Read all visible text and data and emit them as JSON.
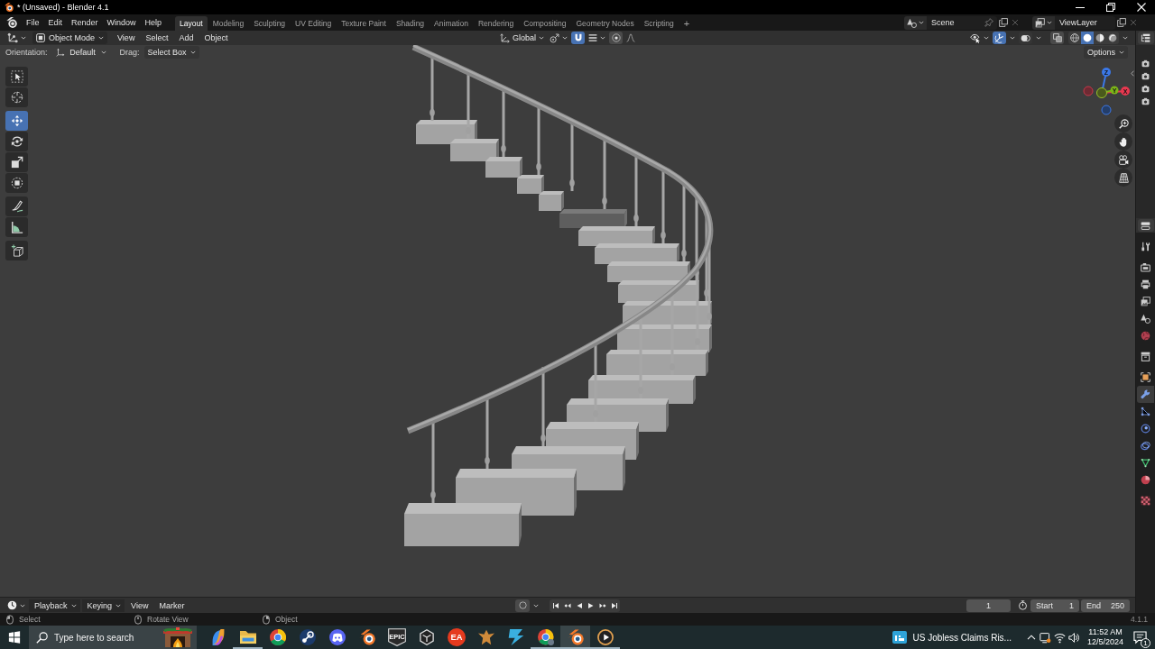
{
  "window": {
    "title": "* (Unsaved) - Blender 4.1"
  },
  "topbar": {
    "menus": [
      "File",
      "Edit",
      "Render",
      "Window",
      "Help"
    ],
    "workspaces": [
      {
        "label": "Layout",
        "selected": true
      },
      {
        "label": "Modeling",
        "selected": false
      },
      {
        "label": "Sculpting",
        "selected": false
      },
      {
        "label": "UV Editing",
        "selected": false
      },
      {
        "label": "Texture Paint",
        "selected": false
      },
      {
        "label": "Shading",
        "selected": false
      },
      {
        "label": "Animation",
        "selected": false
      },
      {
        "label": "Rendering",
        "selected": false
      },
      {
        "label": "Compositing",
        "selected": false
      },
      {
        "label": "Geometry Nodes",
        "selected": false
      },
      {
        "label": "Scripting",
        "selected": false
      }
    ],
    "add_workspace": "+",
    "scene": "Scene",
    "view_layer": "ViewLayer"
  },
  "viewport": {
    "header": {
      "mode": "Object Mode",
      "menus": [
        "View",
        "Select",
        "Add",
        "Object"
      ],
      "transform_orientation": "Global",
      "snap": {
        "on": true
      },
      "proportional_editing": {
        "on": false
      },
      "gizmos": {
        "on": true
      },
      "shading_modes": [
        {
          "kind": "wireframe",
          "selected": false
        },
        {
          "kind": "solid",
          "selected": true
        },
        {
          "kind": "material",
          "selected": false
        },
        {
          "kind": "rendered",
          "selected": false
        }
      ]
    },
    "tool_settings": {
      "orientation_label": "Orientation:",
      "orientation": "Default",
      "drag_label": "Drag:",
      "drag": "Select Box",
      "options": "Options"
    },
    "tool_groups": [
      {
        "tools": [
          {
            "kind": "select_box",
            "selected": false
          },
          {
            "kind": "cursor",
            "selected": false
          }
        ]
      },
      {
        "tools": [
          {
            "kind": "move",
            "selected": true
          },
          {
            "kind": "rotate",
            "selected": false
          },
          {
            "kind": "scale",
            "selected": false
          },
          {
            "kind": "transform",
            "selected": false
          }
        ]
      },
      {
        "tools": [
          {
            "kind": "annotate",
            "selected": false
          },
          {
            "kind": "measure",
            "selected": false
          }
        ]
      },
      {
        "tools": [
          {
            "kind": "add_cube",
            "selected": false
          }
        ]
      }
    ],
    "navigation_gizmo": {
      "axes": [
        "Z",
        "Y",
        "X"
      ]
    }
  },
  "properties_tab_groups": [
    {
      "tabs": [
        {
          "kind": "tool",
          "selected": false
        }
      ]
    },
    {
      "tabs": [
        {
          "kind": "render",
          "selected": false
        },
        {
          "kind": "output",
          "selected": false
        },
        {
          "kind": "view_layer",
          "selected": false
        },
        {
          "kind": "scene",
          "selected": false
        },
        {
          "kind": "world",
          "selected": false
        }
      ]
    },
    {
      "tabs": [
        {
          "kind": "collection",
          "selected": false
        }
      ]
    },
    {
      "tabs": [
        {
          "kind": "object",
          "selected": false
        },
        {
          "kind": "modifiers",
          "selected": true
        },
        {
          "kind": "particles",
          "selected": false
        },
        {
          "kind": "physics",
          "selected": false
        },
        {
          "kind": "constraints",
          "selected": false
        },
        {
          "kind": "data",
          "selected": false
        },
        {
          "kind": "material",
          "selected": false
        }
      ]
    },
    {
      "tabs": [
        {
          "kind": "texture",
          "selected": false
        }
      ]
    }
  ],
  "timeline": {
    "menus": [
      {
        "label": "Playback",
        "kind": "dropdown"
      },
      {
        "label": "Keying",
        "kind": "dropdown"
      },
      {
        "label": "View",
        "kind": "menu"
      },
      {
        "label": "Marker",
        "kind": "menu"
      }
    ],
    "auto_keying": {
      "on": false
    },
    "current_frame": "1",
    "start_label": "Start",
    "start": "1",
    "end_label": "End",
    "end": "250"
  },
  "status_bar": {
    "hints": [
      {
        "kind": "left_click",
        "label": "Select"
      },
      {
        "kind": "middle_click",
        "label": "Rotate View"
      },
      {
        "kind": "right_click",
        "label": "Object"
      }
    ],
    "version": "4.1.1"
  },
  "taskbar": {
    "search": {
      "placeholder": "Type here to search"
    },
    "apps": [
      {
        "kind": "copilot",
        "running": false,
        "selected": false
      },
      {
        "kind": "explorer",
        "running": true,
        "selected": false
      },
      {
        "kind": "chrome",
        "running": false,
        "selected": false
      },
      {
        "kind": "steam",
        "running": false,
        "selected": false
      },
      {
        "kind": "discord",
        "running": false,
        "selected": false
      },
      {
        "kind": "blender",
        "running": false,
        "selected": false
      },
      {
        "kind": "epic",
        "label": "EPIC",
        "running": false,
        "selected": false
      },
      {
        "kind": "unity",
        "running": false,
        "selected": false
      },
      {
        "kind": "ea",
        "label": "EA",
        "running": false,
        "selected": false
      },
      {
        "kind": "figure",
        "running": false,
        "selected": false
      },
      {
        "kind": "prism",
        "running": false,
        "selected": false
      },
      {
        "kind": "chrome_profile",
        "running": true,
        "selected": false
      },
      {
        "kind": "blender",
        "running": true,
        "selected": true
      },
      {
        "kind": "player",
        "running": true,
        "selected": false
      }
    ],
    "news": {
      "headline": "US Jobless Claims Ris..."
    },
    "clock": {
      "time": "11:52 AM",
      "date": "12/5/2024"
    },
    "notifications": {
      "count": "1"
    }
  }
}
